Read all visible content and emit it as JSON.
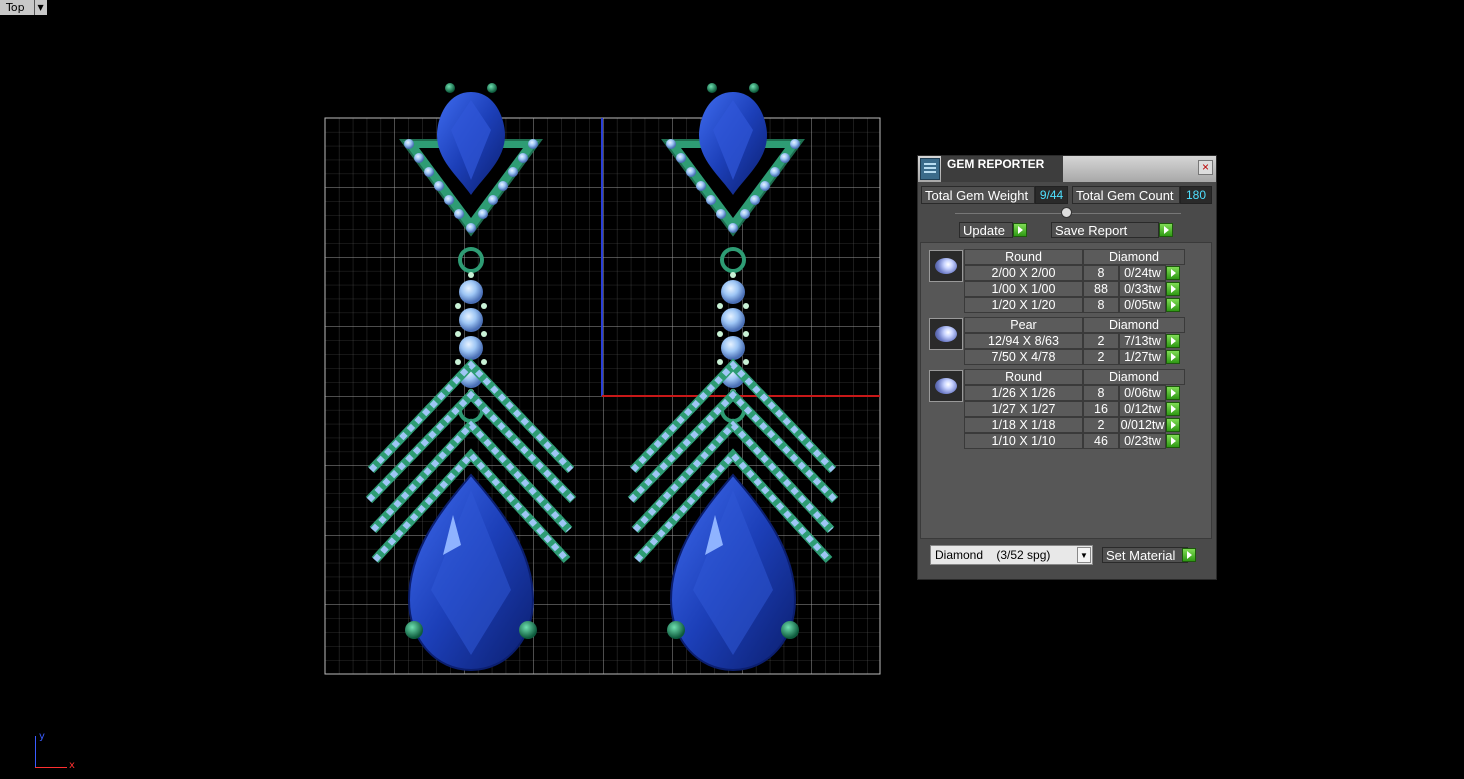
{
  "viewport": {
    "name": "Top"
  },
  "axis": {
    "x": "x",
    "y": "y"
  },
  "gem_reporter": {
    "title": "GEM REPORTER",
    "close": "×",
    "total_weight_label": "Total Gem Weight",
    "total_weight_value": "9/44",
    "total_count_label": "Total Gem Count",
    "total_count_value": "180",
    "update_label": "Update",
    "save_report_label": "Save Report",
    "groups": [
      {
        "shape": "Round",
        "material": "Diamond",
        "rows": [
          {
            "size": "2/00 X 2/00",
            "count": "8",
            "weight": "0/24tw"
          },
          {
            "size": "1/00 X 1/00",
            "count": "88",
            "weight": "0/33tw"
          },
          {
            "size": "1/20 X 1/20",
            "count": "8",
            "weight": "0/05tw"
          }
        ]
      },
      {
        "shape": "Pear",
        "material": "Diamond",
        "rows": [
          {
            "size": "12/94 X 8/63",
            "count": "2",
            "weight": "7/13tw"
          },
          {
            "size": "7/50 X 4/78",
            "count": "2",
            "weight": "1/27tw"
          }
        ]
      },
      {
        "shape": "Round",
        "material": "Diamond",
        "rows": [
          {
            "size": "1/26 X 1/26",
            "count": "8",
            "weight": "0/06tw"
          },
          {
            "size": "1/27 X 1/27",
            "count": "16",
            "weight": "0/12tw"
          },
          {
            "size": "1/18 X 1/18",
            "count": "2",
            "weight": "0/012tw"
          },
          {
            "size": "1/10 X 1/10",
            "count": "46",
            "weight": "0/23tw"
          }
        ]
      }
    ],
    "material_select": "Diamond    (3/52 spg)",
    "set_material_label": "Set Material"
  },
  "colors": {
    "grid": "#8a8a8a",
    "gem_blue": "#1c3fb8",
    "metal_green": "#2e9c74",
    "diamond": "#9ec6f5"
  }
}
